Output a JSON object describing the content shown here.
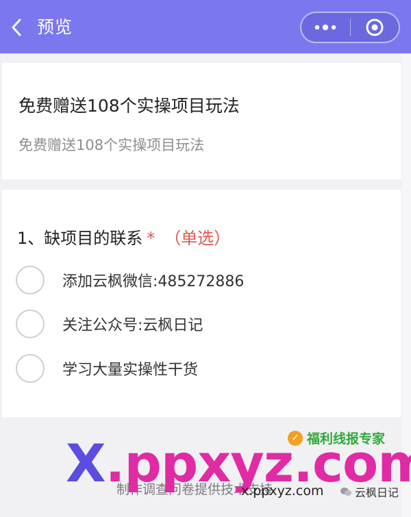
{
  "header": {
    "title": "预览",
    "back_icon": "chevron-left-icon",
    "more_icon": "more-dots-icon",
    "close_icon": "target-circle-icon",
    "background_color": "#7b78ef"
  },
  "survey": {
    "title": "免费赠送108个实操项目玩法",
    "description": "免费赠送108个实操项目玩法"
  },
  "question": {
    "title": "1、缺项目的联系",
    "required_mark": "*",
    "type_label": "（单选）",
    "options": [
      {
        "label": "添加云枫微信:485272886"
      },
      {
        "label": "关注公众号:云枫日记"
      },
      {
        "label": "学习大量实操性干货"
      }
    ]
  },
  "footer": {
    "support_text": "制作调查问卷提供技术支持"
  },
  "watermark": {
    "big_x": "X",
    "big_rest": ".ppxyz.com",
    "small_url": "x.ppxyz.com",
    "brand": "福利线报专家",
    "account": "云枫日记"
  }
}
